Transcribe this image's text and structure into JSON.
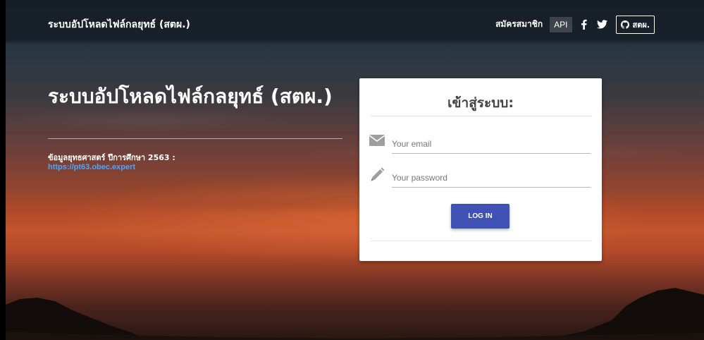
{
  "navbar": {
    "brand": "ระบบอัปโหลดไฟล์กลยุทธ์ (สตผ.)",
    "register_label": "สมัครสมาชิก",
    "api_label": "API",
    "github_label": "สตผ."
  },
  "hero": {
    "title": "ระบบอัปโหลดไฟล์กลยุทธ์ (สตผ.)",
    "info_label": "ข้อมูลยุทธศาสตร์ ปีการศึกษา 2563 :",
    "info_link": "https://pt63.obec.expert"
  },
  "login": {
    "title": "เข้าสู่ระบบ:",
    "email_placeholder": "Your email",
    "password_placeholder": "Your password",
    "submit_label": "LOG IN"
  },
  "colors": {
    "primary_button": "#3f51b5",
    "link": "#4ea4ff"
  }
}
